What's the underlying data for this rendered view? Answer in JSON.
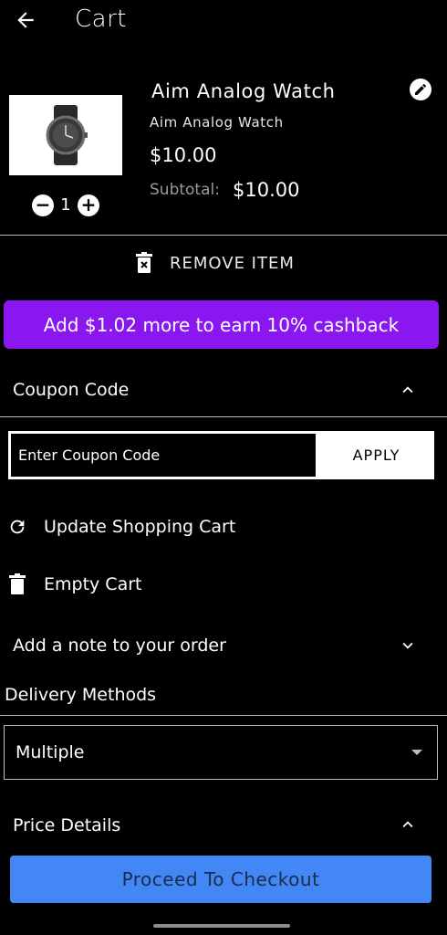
{
  "header": {
    "title": "Cart",
    "back_icon": "arrow-left-icon"
  },
  "product": {
    "name": "Aim Analog Watch",
    "subtitle": "Aim Analog Watch",
    "price": "$10.00",
    "subtotal_label": "Subtotal:",
    "subtotal_value": "$10.00",
    "quantity": "1",
    "image": "watch-image",
    "edit_icon": "pencil-icon"
  },
  "remove": {
    "label": "REMOVE ITEM",
    "icon": "trash-x-icon"
  },
  "cashback": {
    "text": "Add $1.02 more to earn 10% cashback",
    "color": "#8a16f0"
  },
  "coupon": {
    "title": "Coupon Code",
    "placeholder": "Enter Coupon Code",
    "apply_label": "APPLY",
    "expanded": true
  },
  "actions": {
    "update_label": "Update Shopping Cart",
    "update_icon": "refresh-icon",
    "empty_label": "Empty Cart",
    "empty_icon": "trash-icon"
  },
  "note": {
    "title": "Add a note to your order",
    "expanded": false
  },
  "delivery": {
    "title": "Delivery Methods",
    "selected": "Multiple"
  },
  "price_details": {
    "title": "Price Details",
    "expanded": true
  },
  "checkout": {
    "label": "Proceed To Checkout",
    "color": "#4287f5"
  }
}
